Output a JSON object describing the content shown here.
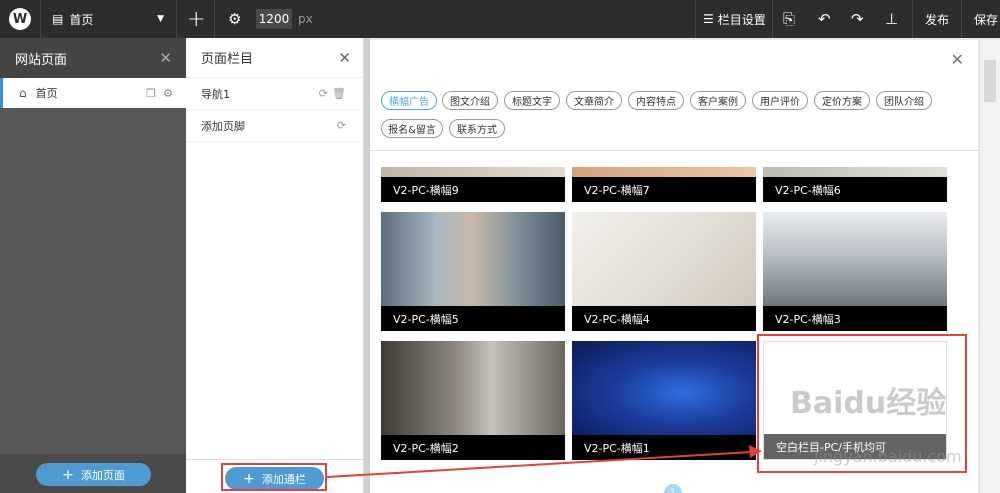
{
  "topbar": {
    "logo": "W",
    "page_select": "首页",
    "width_value": "1200",
    "width_unit": "px",
    "column_settings": "栏目设置",
    "publish": "发布",
    "save": "保存"
  },
  "site_pages": {
    "title": "网站页面",
    "items": [
      {
        "label": "首页"
      }
    ],
    "add_button": "添加页面"
  },
  "page_columns": {
    "title": "页面栏目",
    "items": [
      {
        "label": "导航1"
      },
      {
        "label": "添加页脚"
      }
    ],
    "add_button": "添加通栏"
  },
  "column_picker": {
    "tags": [
      {
        "label": "横幅广告",
        "active": true
      },
      {
        "label": "图文介绍"
      },
      {
        "label": "标题文字"
      },
      {
        "label": "文章简介"
      },
      {
        "label": "内容特点"
      },
      {
        "label": "客户案例"
      },
      {
        "label": "用户评价"
      },
      {
        "label": "定价方案"
      },
      {
        "label": "团队介绍"
      },
      {
        "label": "报名&留言"
      },
      {
        "label": "联系方式"
      }
    ],
    "cards": [
      {
        "label": "V2-PC-横幅9"
      },
      {
        "label": "V2-PC-横幅7"
      },
      {
        "label": "V2-PC-横幅6"
      },
      {
        "label": "V2-PC-横幅5"
      },
      {
        "label": "V2-PC-横幅4"
      },
      {
        "label": "V2-PC-横幅3"
      },
      {
        "label": "V2-PC-横幅2"
      },
      {
        "label": "V2-PC-横幅1"
      },
      {
        "label": "空白栏目-PC/手机均可"
      }
    ],
    "page_number": "1"
  },
  "watermark": {
    "brand": "Baidu经验",
    "url": "jingyan.baidu.com"
  },
  "colors": {
    "accent": "#4e9bd3",
    "topbar": "#2d2d2d",
    "annotation": "#e4403d"
  }
}
